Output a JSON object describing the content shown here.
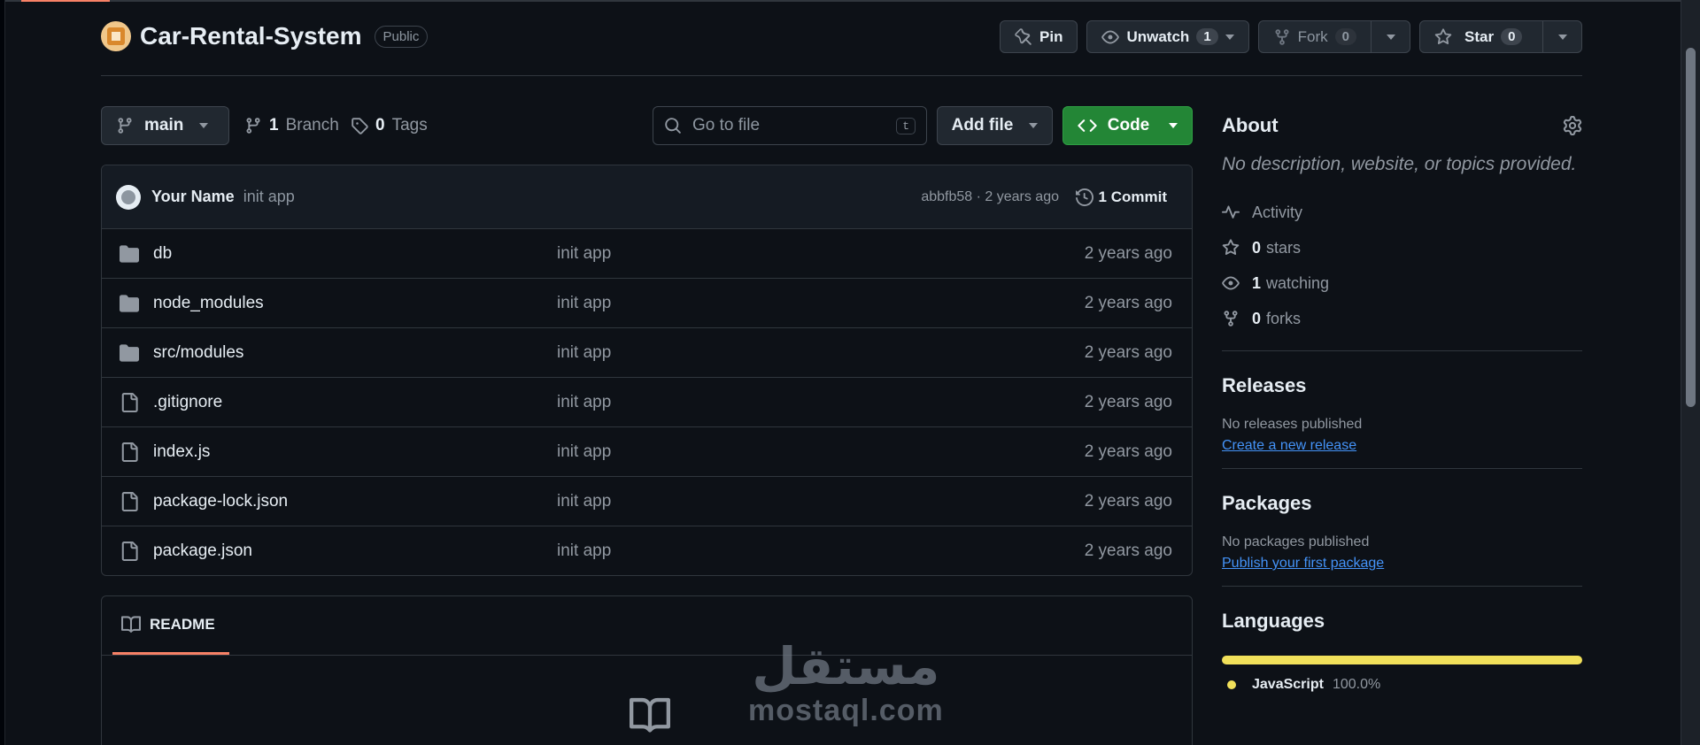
{
  "repo": {
    "name": "Car-Rental-System",
    "visibility": "Public"
  },
  "actions": {
    "pin_label": "Pin",
    "unwatch_label": "Unwatch",
    "unwatch_count": "1",
    "fork_label": "Fork",
    "fork_count": "0",
    "star_label": "Star",
    "star_count": "0"
  },
  "toolbar": {
    "branch": "main",
    "branches_count": "1",
    "branches_label": "Branch",
    "tags_count": "0",
    "tags_label": "Tags",
    "search_placeholder": "Go to file",
    "search_shortcut": "t",
    "add_file_label": "Add file",
    "code_label": "Code"
  },
  "latest_commit": {
    "author": "Your Name",
    "message": "init app",
    "meta": "abbfb58 · 2 years ago",
    "commits_label": "1 Commit"
  },
  "files": [
    {
      "type": "folder",
      "name": "db",
      "commit": "init app",
      "age": "2 years ago"
    },
    {
      "type": "folder",
      "name": "node_modules",
      "commit": "init app",
      "age": "2 years ago"
    },
    {
      "type": "folder",
      "name": "src/modules",
      "commit": "init app",
      "age": "2 years ago"
    },
    {
      "type": "file",
      "name": ".gitignore",
      "commit": "init app",
      "age": "2 years ago"
    },
    {
      "type": "file",
      "name": "index.js",
      "commit": "init app",
      "age": "2 years ago"
    },
    {
      "type": "file",
      "name": "package-lock.json",
      "commit": "init app",
      "age": "2 years ago"
    },
    {
      "type": "file",
      "name": "package.json",
      "commit": "init app",
      "age": "2 years ago"
    }
  ],
  "readme": {
    "tab_label": "README"
  },
  "about": {
    "title": "About",
    "description": "No description, website, or topics provided.",
    "activity_label": "Activity",
    "stars_count": "0",
    "stars_label": "stars",
    "watching_count": "1",
    "watching_label": "watching",
    "forks_count": "0",
    "forks_label": "forks"
  },
  "releases": {
    "title": "Releases",
    "empty_text": "No releases published",
    "link": "Create a new release"
  },
  "packages": {
    "title": "Packages",
    "empty_text": "No packages published",
    "link": "Publish your first package"
  },
  "languages": {
    "title": "Languages",
    "items": [
      {
        "name": "JavaScript",
        "percent": "100.0%",
        "color": "#f1e05a"
      }
    ]
  },
  "watermark": {
    "arabic": "مستقل",
    "latin": "mostaql.com"
  },
  "colors": {
    "background": "#0d1117",
    "accent_green": "#238636",
    "link_blue": "#4493f8",
    "tab_underline": "#f78166"
  }
}
